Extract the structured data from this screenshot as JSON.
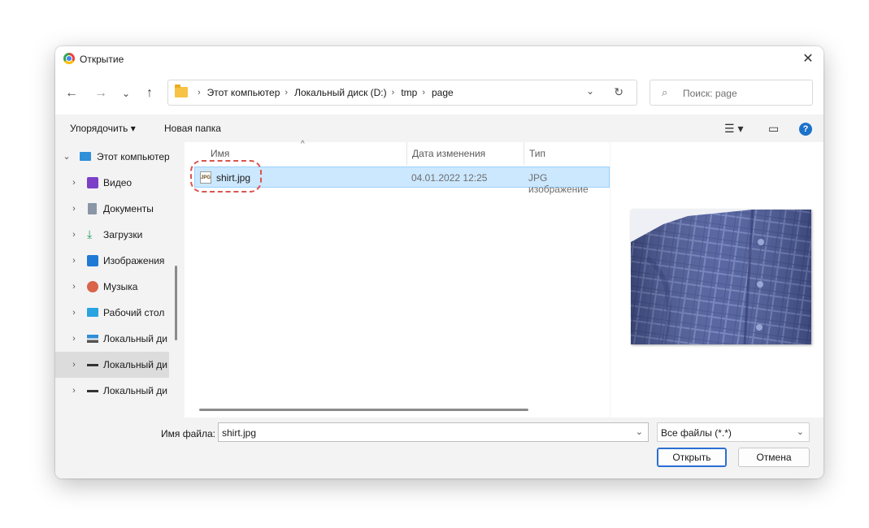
{
  "window": {
    "title": "Открытие",
    "close_glyph": "✕"
  },
  "nav": {
    "back": "←",
    "forward": "→",
    "recent": "⌄",
    "up": "↑"
  },
  "address": {
    "crumbs": [
      "Этот компьютер",
      "Локальный диск (D:)",
      "tmp",
      "page"
    ],
    "separator": "›",
    "dropdown": "⌄",
    "refresh": "↻"
  },
  "search": {
    "placeholder": "Поиск: page",
    "icon": "⌕"
  },
  "toolbar": {
    "organize": "Упорядочить ▾",
    "new_folder": "Новая папка",
    "view": "☰ ▾",
    "pane": "▭",
    "help": "?"
  },
  "sidebar": {
    "items": [
      {
        "label": "Этот компьютер",
        "chevron": "⌄",
        "icon": "computer-icon",
        "color": "#2f8fd8"
      },
      {
        "label": "Видео",
        "chevron": "›",
        "icon": "video-icon",
        "color": "#7b3fc8"
      },
      {
        "label": "Документы",
        "chevron": "›",
        "icon": "document-icon",
        "color": "#6d7a8b"
      },
      {
        "label": "Загрузки",
        "chevron": "›",
        "icon": "download-icon",
        "color": "#1d9e62"
      },
      {
        "label": "Изображения",
        "chevron": "›",
        "icon": "pictures-icon",
        "color": "#1f7ad6"
      },
      {
        "label": "Музыка",
        "chevron": "›",
        "icon": "music-icon",
        "color": "#d9644a"
      },
      {
        "label": "Рабочий стол",
        "chevron": "›",
        "icon": "desktop-icon",
        "color": "#2aa3e0"
      },
      {
        "label": "Локальный ди",
        "chevron": "›",
        "icon": "drive-system-icon",
        "color": "#555555"
      },
      {
        "label": "Локальный ди",
        "chevron": "›",
        "icon": "drive-icon",
        "color": "#333333"
      },
      {
        "label": "Локальный ди",
        "chevron": "›",
        "icon": "drive-icon",
        "color": "#333333"
      }
    ]
  },
  "files": {
    "columns": {
      "name": "Имя",
      "date": "Дата изменения",
      "type": "Тип"
    },
    "sort_indicator": "^",
    "rows": [
      {
        "name": "shirt.jpg",
        "date": "04.01.2022 12:25",
        "type": "JPG изображение",
        "icon_text": "JPG"
      }
    ]
  },
  "bottom": {
    "filename_label": "Имя файла:",
    "filename_value": "shirt.jpg",
    "filter": "Все файлы (*.*)",
    "dd": "⌄",
    "open": "Открыть",
    "cancel": "Отмена"
  },
  "colors": {
    "selection": "#cce8ff",
    "accent": "#2b6ed2",
    "annotation": "#d9544f"
  }
}
